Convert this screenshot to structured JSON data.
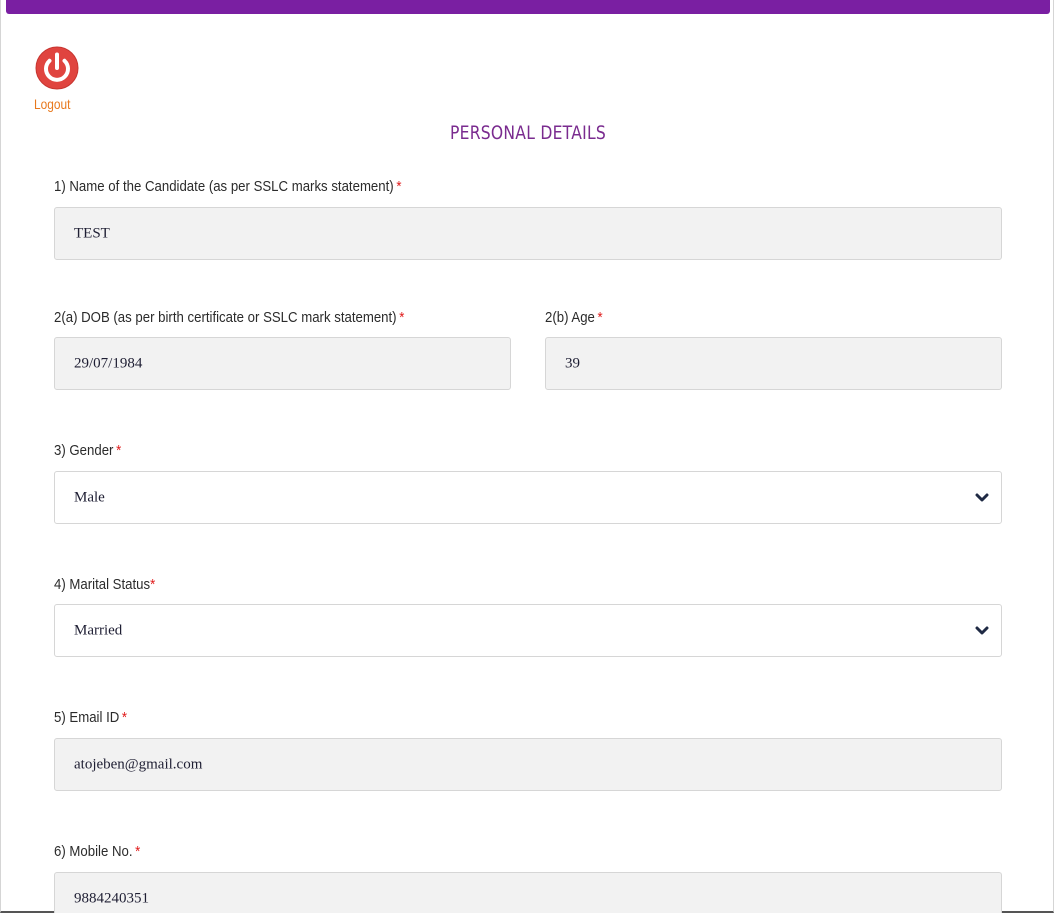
{
  "header": {
    "logout_label": "Logout",
    "title": "PERSONAL DETAILS"
  },
  "colors": {
    "accent_bar": "#7a1fa2",
    "title": "#7a2b8f",
    "logout_icon": "#e0443f",
    "logout_label": "#e8781c",
    "required_mark": "#e01b1b"
  },
  "icons": {
    "logout": "power-icon",
    "select_arrow": "chevron-down-icon"
  },
  "form": {
    "name": {
      "label": "1) Name of the Candidate (as per SSLC marks statement)",
      "required": "*",
      "value": "TEST"
    },
    "dob": {
      "label": "2(a) DOB (as per birth certificate or SSLC mark statement)",
      "required": "*",
      "value": "29/07/1984"
    },
    "age": {
      "label": "2(b) Age",
      "required": "*",
      "value": "39"
    },
    "gender": {
      "label": "3) Gender",
      "required": "*",
      "selected": "Male"
    },
    "marital_status": {
      "label": "4) Marital Status",
      "required": "*",
      "selected": "Married"
    },
    "email": {
      "label": "5) Email ID",
      "required": "*",
      "value": "atojeben@gmail.com"
    },
    "mobile": {
      "label": "6) Mobile No.",
      "required": "*",
      "value": "9884240351"
    }
  }
}
